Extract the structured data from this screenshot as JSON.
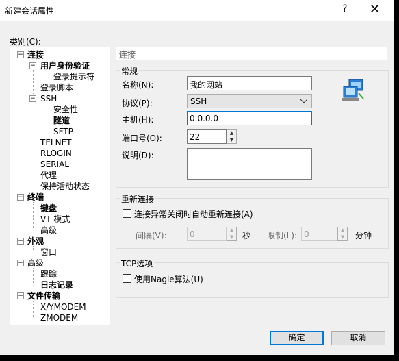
{
  "title": "新建会话属性",
  "help_symbol": "?",
  "close_symbol": "✕",
  "category_label": "类别(C):",
  "tree": [
    {
      "label": "连接",
      "bold": true
    },
    {
      "label": "用户身份验证",
      "bold": true
    },
    {
      "label": "登录提示符",
      "bold": false
    },
    {
      "label": "登录脚本",
      "bold": false
    },
    {
      "label": "SSH",
      "bold": false
    },
    {
      "label": "安全性",
      "bold": false
    },
    {
      "label": "隧道",
      "bold": true
    },
    {
      "label": "SFTP",
      "bold": false
    },
    {
      "label": "TELNET",
      "bold": false
    },
    {
      "label": "RLOGIN",
      "bold": false
    },
    {
      "label": "SERIAL",
      "bold": false
    },
    {
      "label": "代理",
      "bold": false
    },
    {
      "label": "保持活动状态",
      "bold": false
    },
    {
      "label": "终端",
      "bold": true
    },
    {
      "label": "键盘",
      "bold": true
    },
    {
      "label": "VT 模式",
      "bold": false
    },
    {
      "label": "高级",
      "bold": false
    },
    {
      "label": "外观",
      "bold": true
    },
    {
      "label": "窗口",
      "bold": false
    },
    {
      "label": "高级",
      "bold": false
    },
    {
      "label": "跟踪",
      "bold": false
    },
    {
      "label": "日志记录",
      "bold": true
    },
    {
      "label": "文件传输",
      "bold": true
    },
    {
      "label": "X/YMODEM",
      "bold": false
    },
    {
      "label": "ZMODEM",
      "bold": false
    }
  ],
  "section_header": "连接",
  "general": {
    "title": "常规",
    "name_label": "名称(N):",
    "name_value": "我的网站",
    "protocol_label": "协议(P):",
    "protocol_value": "SSH",
    "host_label": "主机(H):",
    "host_value": "0.0.0.0",
    "port_label": "端口号(O):",
    "port_value": "22",
    "desc_label": "说明(D):",
    "desc_value": ""
  },
  "reconnect": {
    "title": "重新连接",
    "checkbox_label": "连接异常关闭时自动重新连接(A)",
    "interval_label": "间隔(V):",
    "interval_value": "0",
    "interval_unit": "秒",
    "limit_label": "限制(L):",
    "limit_value": "0",
    "limit_unit": "分钟"
  },
  "tcp": {
    "title": "TCP选项",
    "nagle_label": "使用Nagle算法(U)"
  },
  "buttons": {
    "ok": "确定",
    "cancel": "取消"
  },
  "icons": {
    "computer": "network-computers-icon"
  }
}
